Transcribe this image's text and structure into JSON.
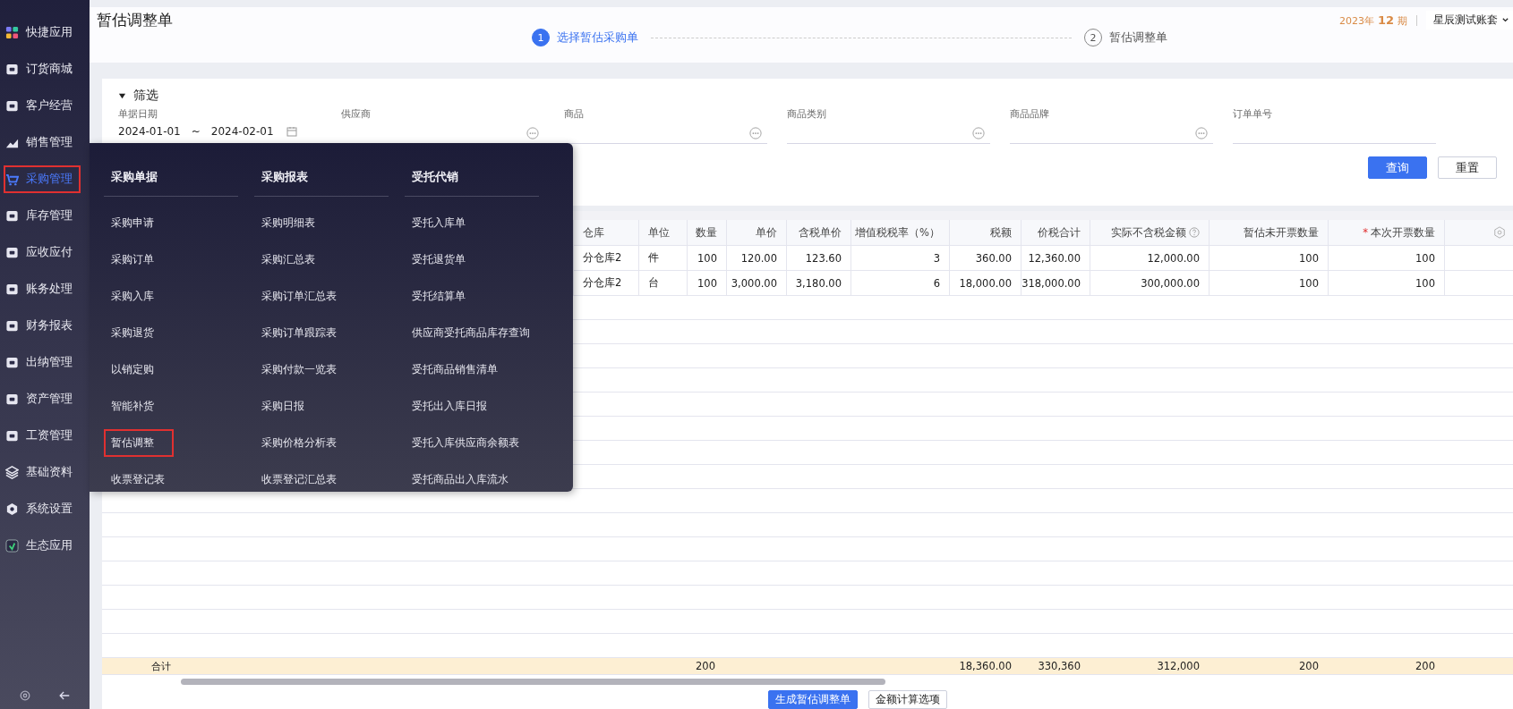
{
  "sidebar": {
    "items": [
      {
        "label": "快捷应用",
        "selected": false,
        "marked": false
      },
      {
        "label": "订货商城",
        "selected": false,
        "marked": false
      },
      {
        "label": "客户经营",
        "selected": false,
        "marked": false
      },
      {
        "label": "销售管理",
        "selected": false,
        "marked": false
      },
      {
        "label": "采购管理",
        "selected": true,
        "marked": true
      },
      {
        "label": "库存管理",
        "selected": false,
        "marked": false
      },
      {
        "label": "应收应付",
        "selected": false,
        "marked": false
      },
      {
        "label": "账务处理",
        "selected": false,
        "marked": false
      },
      {
        "label": "财务报表",
        "selected": false,
        "marked": false
      },
      {
        "label": "出纳管理",
        "selected": false,
        "marked": false
      },
      {
        "label": "资产管理",
        "selected": false,
        "marked": false
      },
      {
        "label": "工资管理",
        "selected": false,
        "marked": false
      },
      {
        "label": "基础资料",
        "selected": false,
        "marked": false
      },
      {
        "label": "系统设置",
        "selected": false,
        "marked": false
      },
      {
        "label": "生态应用",
        "selected": false,
        "marked": false
      }
    ]
  },
  "header": {
    "title": "暂估调整单",
    "period": {
      "year": "2023年",
      "month": "12",
      "unit": "期"
    },
    "account": "星辰测试账套",
    "steps": [
      {
        "number": "1",
        "label": "选择暂估采购单",
        "selected": true
      },
      {
        "number": "2",
        "label": "暂估调整单",
        "selected": false
      }
    ]
  },
  "filter": {
    "title": "筛选",
    "expanded": true,
    "fields": [
      {
        "kind": "daterange",
        "label": "单据日期",
        "from": "2024-01-01",
        "separator": "~",
        "to": "2024-02-01"
      },
      {
        "kind": "picker",
        "label": "供应商"
      },
      {
        "kind": "picker",
        "label": "商品"
      },
      {
        "kind": "picker",
        "label": "商品类别"
      },
      {
        "kind": "picker",
        "label": "商品品牌"
      },
      {
        "kind": "text",
        "label": "订单单号"
      }
    ],
    "buttons": [
      {
        "label": "查询",
        "primary": true
      },
      {
        "label": "重置",
        "primary": false
      }
    ]
  },
  "menu": {
    "columns": [
      {
        "title": "采购单据",
        "items": [
          {
            "label": "采购申请",
            "marked": false
          },
          {
            "label": "采购订单",
            "marked": false
          },
          {
            "label": "采购入库",
            "marked": false
          },
          {
            "label": "采购退货",
            "marked": false
          },
          {
            "label": "以销定购",
            "marked": false
          },
          {
            "label": "智能补货",
            "marked": false
          },
          {
            "label": "暂估调整",
            "marked": true
          },
          {
            "label": "收票登记表",
            "marked": false
          }
        ]
      },
      {
        "title": "采购报表",
        "items": [
          {
            "label": "采购明细表",
            "marked": false
          },
          {
            "label": "采购汇总表",
            "marked": false
          },
          {
            "label": "采购订单汇总表",
            "marked": false
          },
          {
            "label": "采购订单跟踪表",
            "marked": false
          },
          {
            "label": "采购付款一览表",
            "marked": false
          },
          {
            "label": "采购日报",
            "marked": false
          },
          {
            "label": "采购价格分析表",
            "marked": false
          },
          {
            "label": "收票登记汇总表",
            "marked": false
          }
        ]
      },
      {
        "title": "受托代销",
        "items": [
          {
            "label": "受托入库单",
            "marked": false
          },
          {
            "label": "受托退货单",
            "marked": false
          },
          {
            "label": "受托结算单",
            "marked": false
          },
          {
            "label": "供应商受托商品库存查询",
            "marked": false
          },
          {
            "label": "受托商品销售清单",
            "marked": false
          },
          {
            "label": "受托出入库日报",
            "marked": false
          },
          {
            "label": "受托入库供应商余额表",
            "marked": false
          },
          {
            "label": "受托商品出入库流水",
            "marked": false
          }
        ]
      }
    ]
  },
  "table": {
    "columns": [
      {
        "label": "仓库",
        "help": false
      },
      {
        "label": "单位",
        "help": false
      },
      {
        "label": "数量",
        "help": false
      },
      {
        "label": "单价",
        "help": false
      },
      {
        "label": "含税单价",
        "help": false
      },
      {
        "label": "增值税税率（%）",
        "help": false
      },
      {
        "label": "税额",
        "help": false
      },
      {
        "label": "价税合计",
        "help": false
      },
      {
        "label": "实际不含税金额",
        "help": true
      },
      {
        "label": "暂估未开票数量",
        "help": false
      },
      {
        "label": "本次开票数量",
        "help": false,
        "required_mark": "*"
      }
    ],
    "rows": [
      [
        "分仓库2",
        "件",
        "100",
        "120.00",
        "123.60",
        "3",
        "360.00",
        "12,360.00",
        "12,000.00",
        "100",
        "100"
      ],
      [
        "分仓库2",
        "台",
        "100",
        "3,000.00",
        "3,180.00",
        "6",
        "18,000.00",
        "318,000.00",
        "300,000.00",
        "100",
        "100"
      ]
    ],
    "summary": {
      "label": "合计",
      "cells": [
        "",
        "",
        "200",
        "",
        "",
        "",
        "18,360.00",
        "330,360",
        "312,000",
        "200",
        "200"
      ]
    }
  },
  "actions": [
    {
      "label": "生成暂估调整单",
      "primary": true
    },
    {
      "label": "金额计算选项",
      "primary": false
    }
  ]
}
